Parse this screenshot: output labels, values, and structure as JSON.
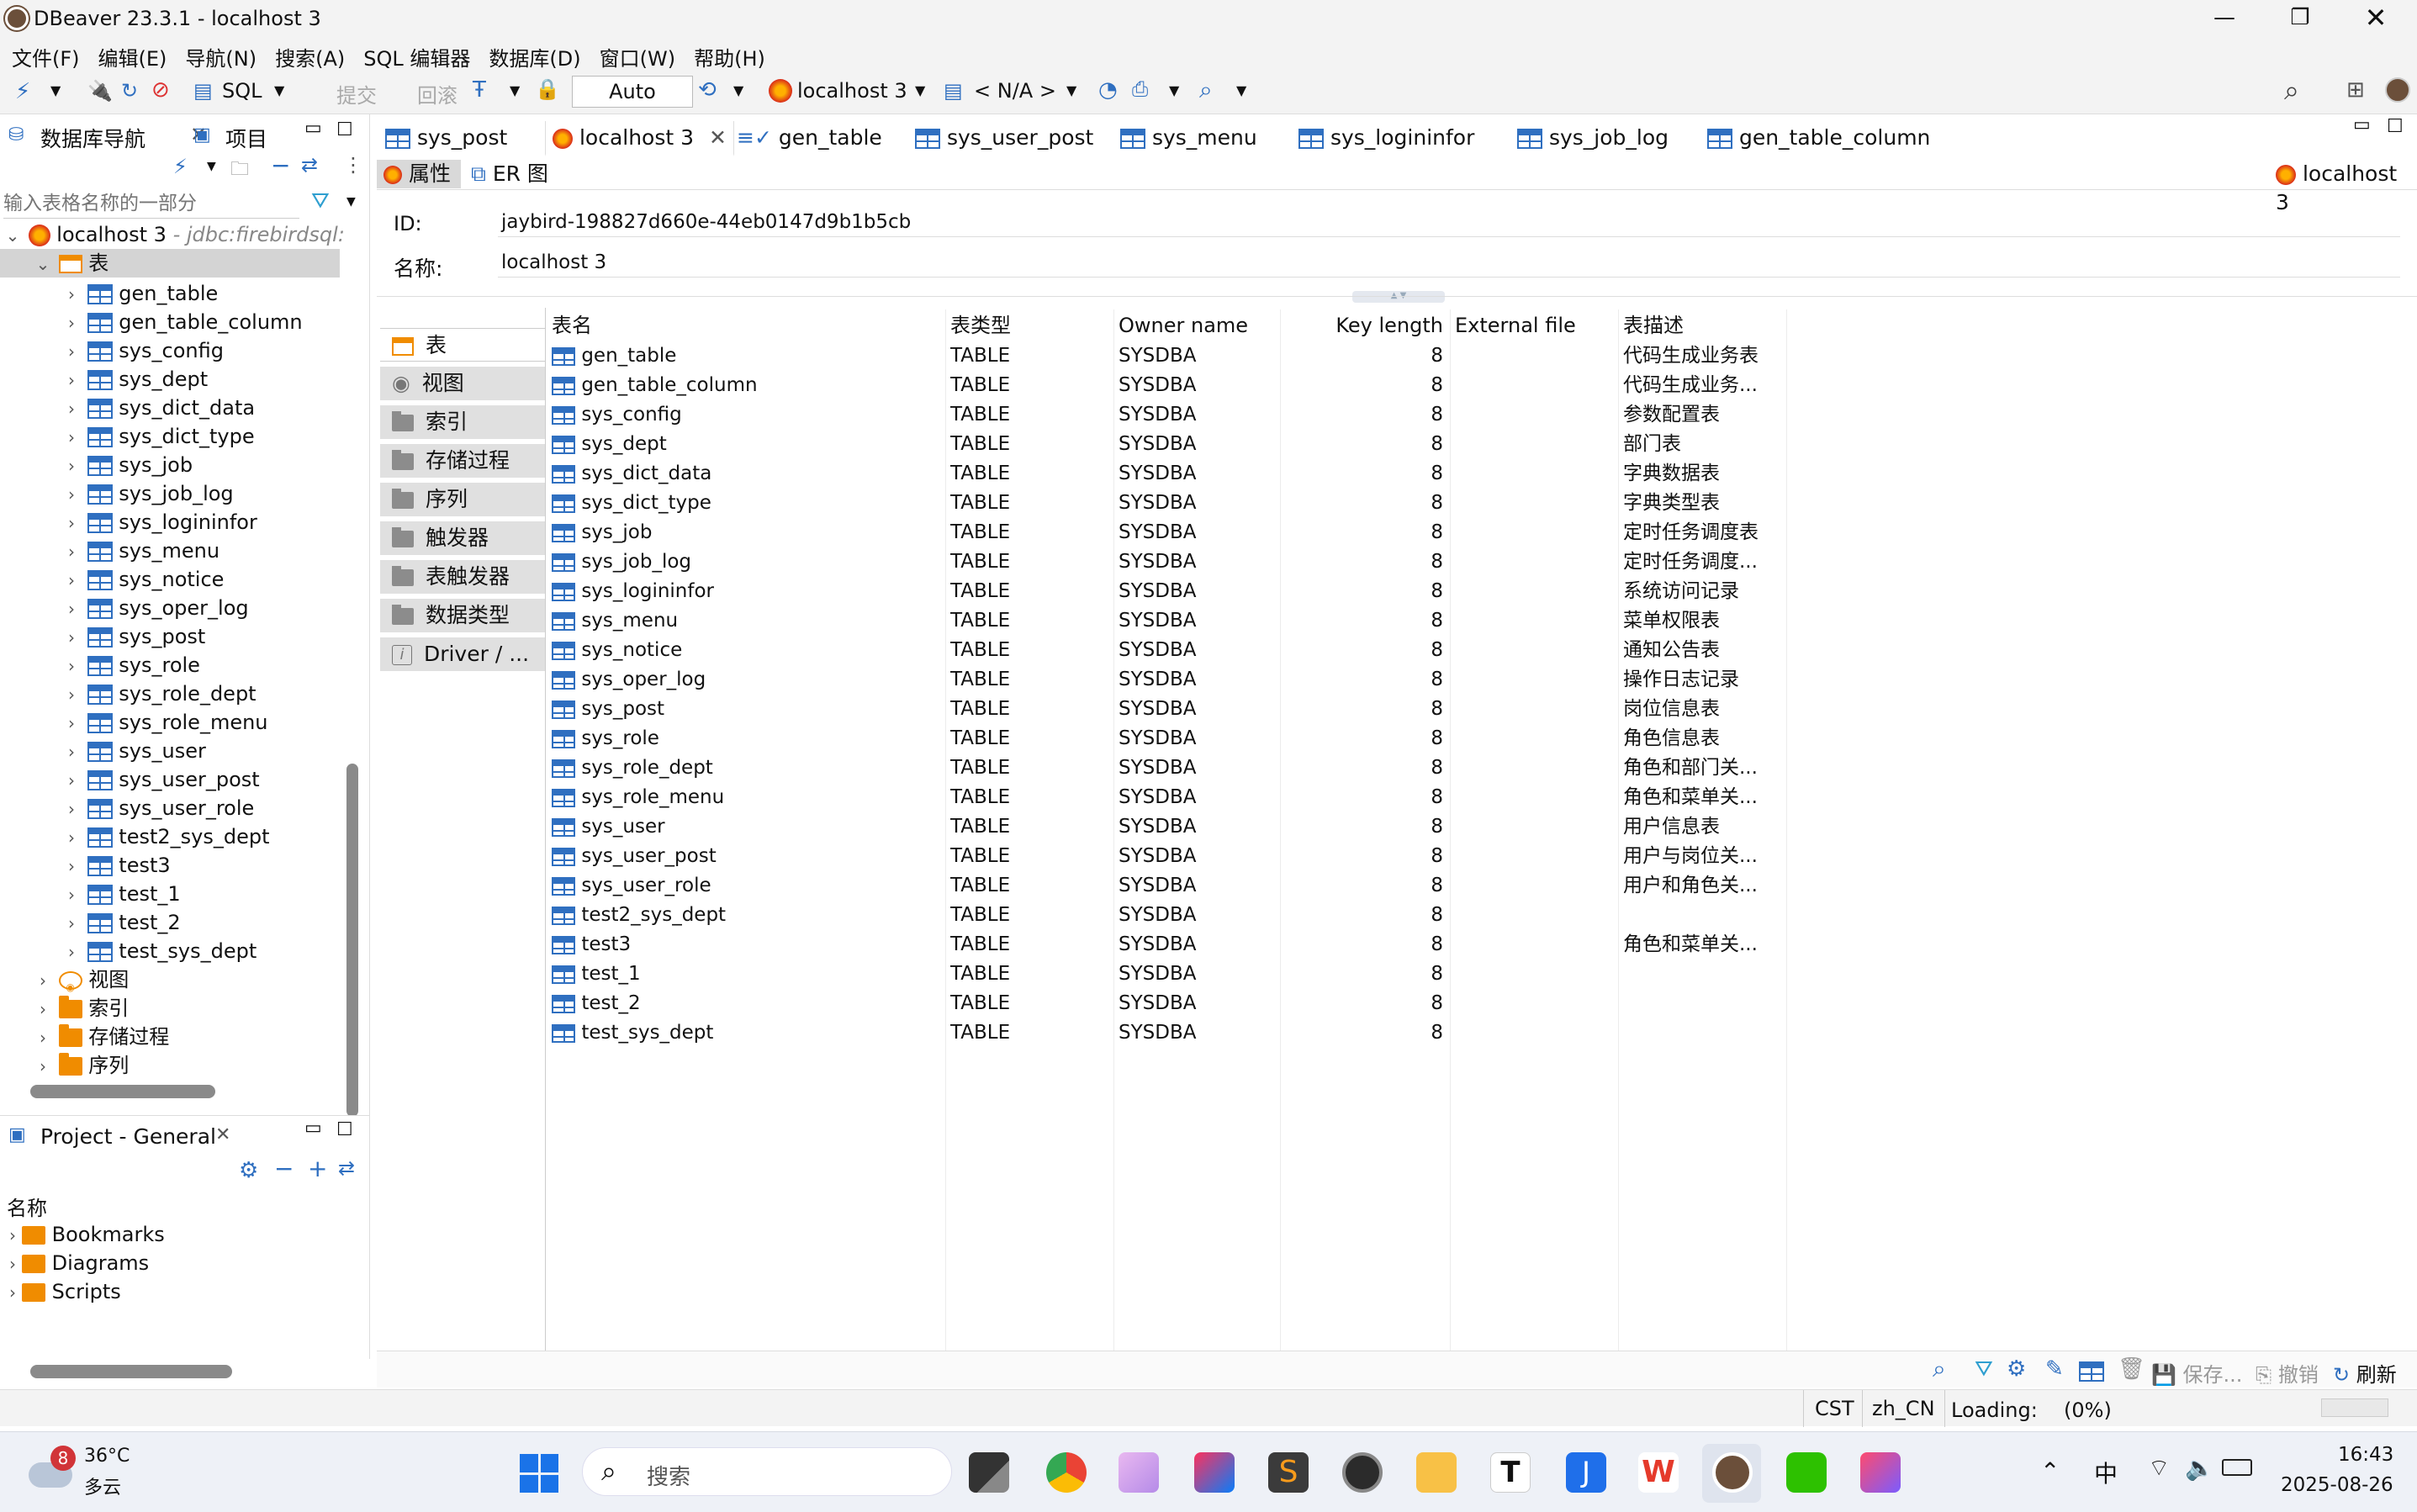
{
  "window": {
    "title": "DBeaver 23.3.1 - localhost 3"
  },
  "menu": [
    "文件(F)",
    "编辑(E)",
    "导航(N)",
    "搜索(A)",
    "SQL 编辑器",
    "数据库(D)",
    "窗口(W)",
    "帮助(H)"
  ],
  "toolbar": {
    "sql_label": "SQL",
    "commit_label": "提交",
    "rollback_label": "回滚",
    "mode": "Auto",
    "connection": "localhost 3",
    "schema": "< N/A >"
  },
  "nav": {
    "tab_db": "数据库导航",
    "tab_project": "项目",
    "filter_placeholder": "输入表格名称的一部分",
    "connection_label": "localhost 3",
    "connection_url": "- jdbc:firebirdsql:",
    "tables_folder": "表",
    "tables": [
      "gen_table",
      "gen_table_column",
      "sys_config",
      "sys_dept",
      "sys_dict_data",
      "sys_dict_type",
      "sys_job",
      "sys_job_log",
      "sys_logininfor",
      "sys_menu",
      "sys_notice",
      "sys_oper_log",
      "sys_post",
      "sys_role",
      "sys_role_dept",
      "sys_role_menu",
      "sys_user",
      "sys_user_post",
      "sys_user_role",
      "test2_sys_dept",
      "test3",
      "test_1",
      "test_2",
      "test_sys_dept"
    ],
    "folders": [
      "视图",
      "索引",
      "存储过程",
      "序列"
    ]
  },
  "project": {
    "title": "Project - General",
    "col_header": "名称",
    "items": [
      "Bookmarks",
      "Diagrams",
      "Scripts"
    ]
  },
  "editor_tabs": [
    "sys_post",
    "localhost 3",
    "gen_table",
    "sys_user_post",
    "sys_menu",
    "sys_logininfor",
    "sys_job_log",
    "gen_table_column"
  ],
  "subtabs": {
    "properties": "属性",
    "er": "ER 图",
    "right_label": "localhost 3"
  },
  "props": {
    "id_label": "ID:",
    "id_value": "jaybird-198827d660e-44eb0147d9b1b5cb",
    "name_label": "名称:",
    "name_value": "localhost 3"
  },
  "side_buttons": [
    "表",
    "视图",
    "索引",
    "存储过程",
    "序列",
    "触发器",
    "表触发器",
    "数据类型",
    "Driver / ..."
  ],
  "table": {
    "headers": [
      "表名",
      "表类型",
      "Owner name",
      "Key length",
      "External file",
      "表描述"
    ],
    "rows": [
      [
        "gen_table",
        "TABLE",
        "SYSDBA",
        "8",
        "",
        "代码生成业务表"
      ],
      [
        "gen_table_column",
        "TABLE",
        "SYSDBA",
        "8",
        "",
        "代码生成业务..."
      ],
      [
        "sys_config",
        "TABLE",
        "SYSDBA",
        "8",
        "",
        "参数配置表"
      ],
      [
        "sys_dept",
        "TABLE",
        "SYSDBA",
        "8",
        "",
        "部门表"
      ],
      [
        "sys_dict_data",
        "TABLE",
        "SYSDBA",
        "8",
        "",
        "字典数据表"
      ],
      [
        "sys_dict_type",
        "TABLE",
        "SYSDBA",
        "8",
        "",
        "字典类型表"
      ],
      [
        "sys_job",
        "TABLE",
        "SYSDBA",
        "8",
        "",
        "定时任务调度表"
      ],
      [
        "sys_job_log",
        "TABLE",
        "SYSDBA",
        "8",
        "",
        "定时任务调度..."
      ],
      [
        "sys_logininfor",
        "TABLE",
        "SYSDBA",
        "8",
        "",
        "系统访问记录"
      ],
      [
        "sys_menu",
        "TABLE",
        "SYSDBA",
        "8",
        "",
        "菜单权限表"
      ],
      [
        "sys_notice",
        "TABLE",
        "SYSDBA",
        "8",
        "",
        "通知公告表"
      ],
      [
        "sys_oper_log",
        "TABLE",
        "SYSDBA",
        "8",
        "",
        "操作日志记录"
      ],
      [
        "sys_post",
        "TABLE",
        "SYSDBA",
        "8",
        "",
        "岗位信息表"
      ],
      [
        "sys_role",
        "TABLE",
        "SYSDBA",
        "8",
        "",
        "角色信息表"
      ],
      [
        "sys_role_dept",
        "TABLE",
        "SYSDBA",
        "8",
        "",
        "角色和部门关..."
      ],
      [
        "sys_role_menu",
        "TABLE",
        "SYSDBA",
        "8",
        "",
        "角色和菜单关..."
      ],
      [
        "sys_user",
        "TABLE",
        "SYSDBA",
        "8",
        "",
        "用户信息表"
      ],
      [
        "sys_user_post",
        "TABLE",
        "SYSDBA",
        "8",
        "",
        "用户与岗位关..."
      ],
      [
        "sys_user_role",
        "TABLE",
        "SYSDBA",
        "8",
        "",
        "用户和角色关..."
      ],
      [
        "test2_sys_dept",
        "TABLE",
        "SYSDBA",
        "8",
        "",
        ""
      ],
      [
        "test3",
        "TABLE",
        "SYSDBA",
        "8",
        "",
        "角色和菜单关..."
      ],
      [
        "test_1",
        "TABLE",
        "SYSDBA",
        "8",
        "",
        ""
      ],
      [
        "test_2",
        "TABLE",
        "SYSDBA",
        "8",
        "",
        ""
      ],
      [
        "test_sys_dept",
        "TABLE",
        "SYSDBA",
        "8",
        "",
        ""
      ]
    ]
  },
  "bottom_actions": {
    "save": "保存...",
    "cancel": "撤销",
    "refresh": "刷新"
  },
  "status": {
    "tz": "CST",
    "locale": "zh_CN",
    "loading": "Loading:",
    "percent": "(0%)"
  },
  "taskbar": {
    "weather_temp": "36°C",
    "weather_desc": "多云",
    "weather_badge": "8",
    "search_placeholder": "搜索",
    "ime": "中",
    "time": "16:43",
    "date": "2025-08-26"
  }
}
